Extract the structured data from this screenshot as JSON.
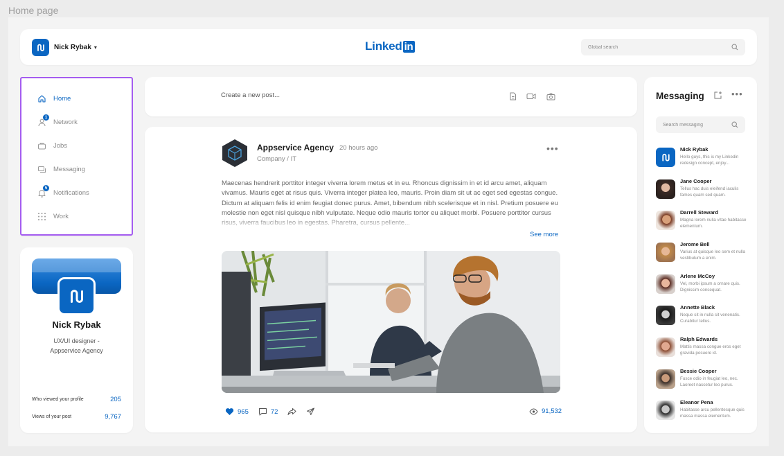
{
  "frame": {
    "label": "Home page"
  },
  "header": {
    "user_name": "Nick Rybak",
    "brand_text": "Linked",
    "brand_in": "in",
    "search_placeholder": "Global search"
  },
  "nav": {
    "items": [
      {
        "label": "Home",
        "icon": "home-icon",
        "active": true
      },
      {
        "label": "Network",
        "icon": "person-icon",
        "badge": "1"
      },
      {
        "label": "Jobs",
        "icon": "briefcase-icon"
      },
      {
        "label": "Messaging",
        "icon": "chat-icon"
      },
      {
        "label": "Notifications",
        "icon": "bell-icon",
        "badge": "5"
      },
      {
        "label": "Work",
        "icon": "grid-icon"
      }
    ]
  },
  "profile": {
    "name": "Nick Rybak",
    "role": "UX/UI designer - Appservice Agency",
    "stats": [
      {
        "label": "Who viewed your profile",
        "value": "205"
      },
      {
        "label": "Views of your post",
        "value": "9,767"
      }
    ]
  },
  "composer": {
    "placeholder": "Create a new post...",
    "icons": [
      "document-icon",
      "video-icon",
      "camera-icon"
    ]
  },
  "post": {
    "author": "Appservice Agency",
    "time": "20 hours ago",
    "subtitle": "Company / IT",
    "text": "Maecenas hendrerit porttitor integer viverra lorem metus et in eu. Rhoncus dignissim in et id arcu amet, aliquam vivamus. Mauris eget at risus quis. Viverra integer platea leo, mauris. Proin diam sit ut ac eget sed egestas congue. Dictum at aliquam felis id enim feugiat donec purus. Amet, bibendum nibh scelerisque et in nisl. Pretium posuere eu molestie non eget nisl quisque nibh vulputate. Neque odio mauris tortor eu aliquet morbi. Posuere porttitor cursus risus, viverra faucibus leo in egestas. Pharetra, cursus pellente...",
    "see_more": "See more",
    "likes": "965",
    "comments": "72",
    "views": "91,532"
  },
  "messaging": {
    "title": "Messaging",
    "search_placeholder": "Search messaging",
    "conversations": [
      {
        "name": "Nick Rybak",
        "preview": "Hello guys, this is my Linkedin redesign concept, enjoy..."
      },
      {
        "name": "Jane Cooper",
        "preview": "Tellus hac duis eleifend iaculis fames quam sed quam."
      },
      {
        "name": "Darrell Steward",
        "preview": "Magna lorem nulla vitae habitasse elementum."
      },
      {
        "name": "Jerome Bell",
        "preview": "Varius at quisque leo sem et nulla vestibulum a enim."
      },
      {
        "name": "Arlene McCoy",
        "preview": "Vel, morbi ipsum a ornare quis. Dignissim consequat."
      },
      {
        "name": "Annette Black",
        "preview": "Neque sit in nulla sit venenatis. Curabitur tellus."
      },
      {
        "name": "Ralph Edwards",
        "preview": "Mattis massa congue eros eget gravida posuere id."
      },
      {
        "name": "Bessie Cooper",
        "preview": "Fusce odio in feugiat leo, nec. Laoreet nascetur leo purus."
      },
      {
        "name": "Eleanor Pena",
        "preview": "Habitasse arcu pellentesque quis massa massa elementum."
      }
    ]
  },
  "colors": {
    "accent": "#0a66c2",
    "highlight_border": "#a45cf0"
  }
}
